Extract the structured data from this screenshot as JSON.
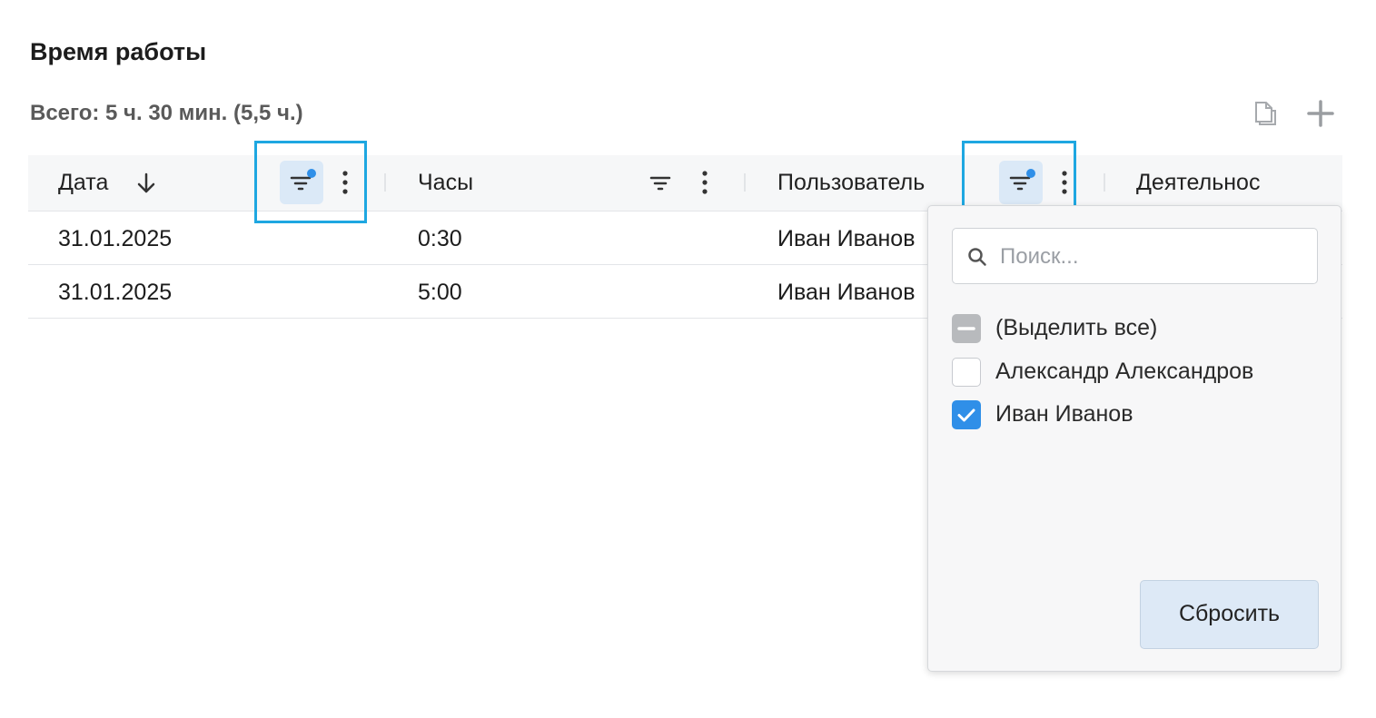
{
  "page": {
    "title": "Время работы",
    "total": "Всего: 5 ч. 30 мин. (5,5 ч.)"
  },
  "toolbar": {
    "copy_icon": "copy-icon",
    "add_icon": "plus-icon"
  },
  "table": {
    "columns": [
      {
        "label": "Дата",
        "sort": "descending",
        "filter_active": true
      },
      {
        "label": "Часы",
        "filter_active": false
      },
      {
        "label": "Пользователь",
        "filter_active": true
      },
      {
        "label": "Деятельнос"
      }
    ],
    "rows": [
      {
        "date": "31.01.2025",
        "hours": "0:30",
        "user": "Иван Иванов"
      },
      {
        "date": "31.01.2025",
        "hours": "5:00",
        "user": "Иван Иванов"
      }
    ]
  },
  "filter_popup": {
    "search_placeholder": "Поиск...",
    "search_value": "",
    "options": [
      {
        "label": "(Выделить все)",
        "state": "partial"
      },
      {
        "label": "Александр Александров",
        "state": "unchecked"
      },
      {
        "label": "Иван Иванов",
        "state": "checked"
      }
    ],
    "reset_label": "Сбросить"
  },
  "colors": {
    "accent": "#2f8fe8",
    "highlight_border": "#1ea7e1",
    "active_filter_bg": "#dbe9f7",
    "header_bg": "#f6f7f8"
  }
}
